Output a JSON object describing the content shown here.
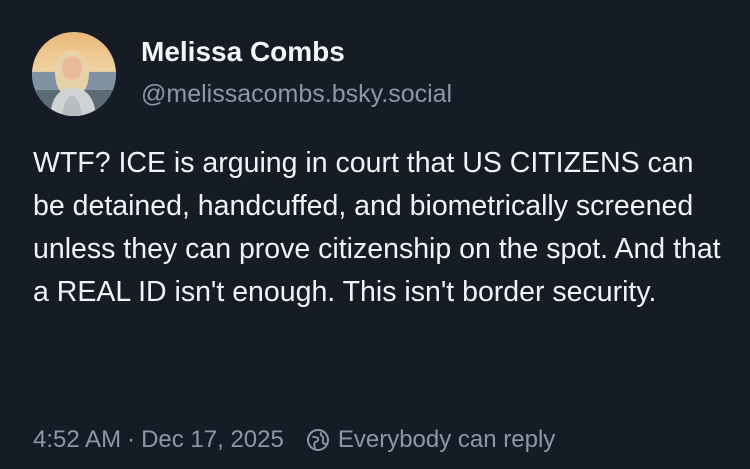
{
  "post": {
    "author_name": "Melissa Combs",
    "author_handle": "@melissacombs.bsky.social",
    "text": "WTF? ICE is arguing in court that US CITIZENS can be detained, handcuffed, and biometrically screened unless they can prove citizenship on the spot. And that a REAL ID isn't enough. This isn't border security.",
    "time": "4:52 AM",
    "separator": "·",
    "date": "Dec 17, 2025",
    "reply_setting": "Everybody can reply"
  },
  "icons": {
    "avatar": "profile-photo",
    "reply_setting_icon": "globe-icon"
  },
  "colors": {
    "background": "#151c26",
    "text_primary": "#f1f3f5",
    "text_secondary": "#8a98ab"
  }
}
